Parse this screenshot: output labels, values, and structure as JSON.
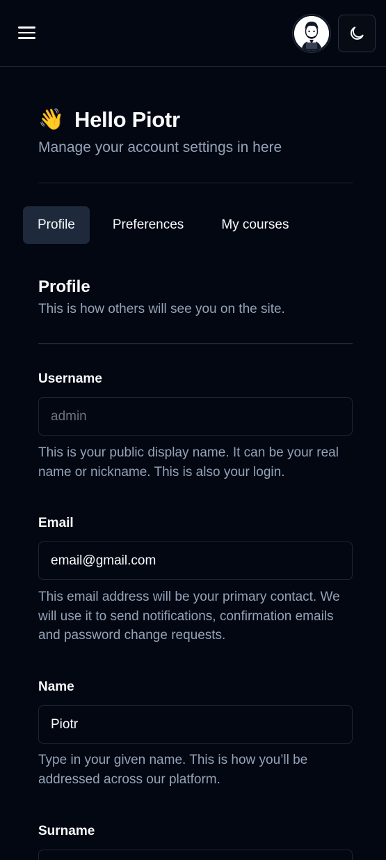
{
  "header": {
    "menu_icon": "hamburger-menu-icon",
    "avatar_icon": "user-avatar-icon",
    "theme_icon": "moon-icon"
  },
  "greeting": {
    "emoji": "👋",
    "title": "Hello Piotr",
    "subtitle": "Manage your account settings in here"
  },
  "tabs": [
    {
      "label": "Profile",
      "active": true
    },
    {
      "label": "Preferences",
      "active": false
    },
    {
      "label": "My courses",
      "active": false
    }
  ],
  "profile": {
    "title": "Profile",
    "description": "This is how others will see you on the site.",
    "fields": {
      "username": {
        "label": "Username",
        "value": "admin",
        "disabled": true,
        "help": "This is your public display name. It can be your real name or nickname. This is also your login."
      },
      "email": {
        "label": "Email",
        "value": "email@gmail.com",
        "help": "This email address will be your primary contact. We will use it to send notifications, confirmation emails and password change requests."
      },
      "name": {
        "label": "Name",
        "value": "Piotr",
        "help": "Type in your given name. This is how you’ll be addressed across our platform."
      },
      "surname": {
        "label": "Surname",
        "value": ""
      }
    }
  },
  "colors": {
    "background": "#030712",
    "text": "#f8fafc",
    "muted": "#94a3b8",
    "border": "#1e2533",
    "active_tab": "#1e293b"
  }
}
